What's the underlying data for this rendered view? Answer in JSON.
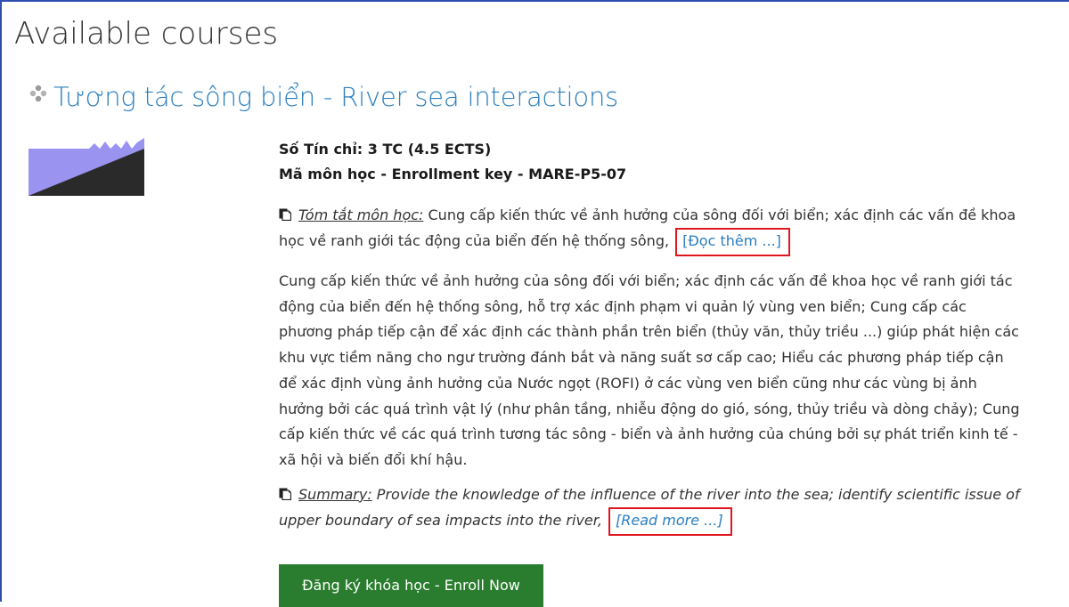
{
  "page": {
    "title": "Available courses"
  },
  "course": {
    "icon": "course-category-icon",
    "title": "Tương tác sông biển - River sea interactions",
    "thumbnail": {
      "icon": "wave-thumbnail-image",
      "colors": {
        "sky": "#9a93f0",
        "land": "#2a2a2a"
      }
    },
    "credits": "Số Tín chỉ: 3 TC (4.5 ECTS)",
    "enrollment_key": "Mã môn học - Enrollment key - MARE-P5-07",
    "vi_summary": {
      "label": "Tóm tắt môn học:",
      "line1": " Cung cấp kiến thức về ảnh hưởng của sông đối với biển; xác định các vấn đề khoa",
      "line2": "học về ranh giới tác động của biển đến hệ thống sông,",
      "read_more": "[Đọc thêm ...]"
    },
    "full_description": [
      "Cung cấp kiến thức về ảnh hưởng của sông đối với biển; xác định các vấn đề khoa học về ranh giới tác",
      "động của biển đến hệ thống sông, hỗ trợ xác định phạm vi quản lý vùng ven biển;  Cung cấp các",
      "phương pháp tiếp cận để xác định các thành phần trên biển (thủy văn, thủy triều ...) giúp phát hiện các",
      "khu vực tiềm năng cho ngư trường đánh bắt và năng suất sơ cấp cao; Hiểu các phương pháp tiếp cận",
      "để xác định vùng ảnh hưởng của Nước ngọt (ROFI) ở các vùng ven biển cũng như các vùng bị ảnh",
      "hưởng bởi các quá trình vật lý (như phân tầng, nhiễu động do gió, sóng, thủy triều và dòng chảy); Cung",
      "cấp kiến thức về các quá trình tương tác sông - biển và ảnh hưởng của chúng bởi sự phát triển kinh tế -",
      "xã hội và biến đổi khí hậu."
    ],
    "en_summary": {
      "label": "Summary:",
      "line1": " Provide the knowledge of the influence of the river into the sea; identify scientific issue of",
      "line2": "upper boundary of sea impacts into the river,",
      "read_more": "[Read more ...]"
    },
    "enroll_button": "Đăng ký khóa học - Enroll Now",
    "doc_icon": "document-icon"
  },
  "colors": {
    "link": "#2b7fc0",
    "button": "#2a7d2e",
    "highlight_box": "#e0161f",
    "frame": "#2f4fb0"
  }
}
